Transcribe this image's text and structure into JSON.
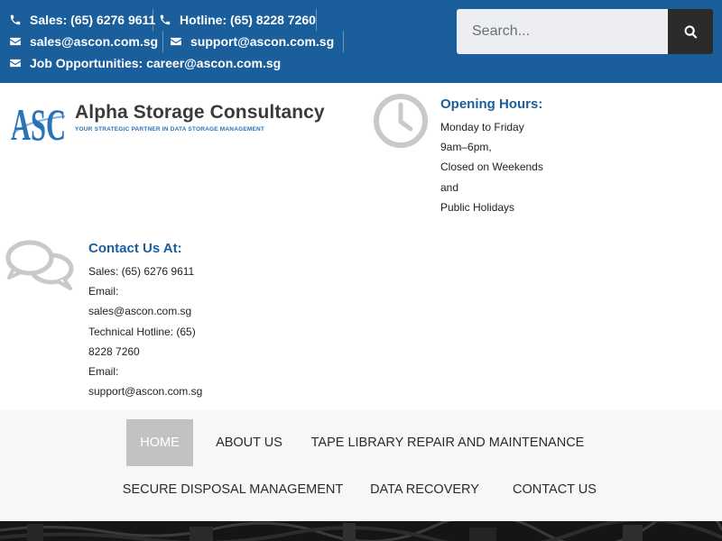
{
  "topbar": {
    "sales": "Sales: (65) 6276 9611",
    "hotline": "Hotline: (65) 8228 7260",
    "sales_email": "sales@ascon.com.sg",
    "support_email": "support@ascon.com.sg",
    "jobs": "Job Opportunities: career@ascon.com.sg",
    "background_color": "#1b5e9c"
  },
  "search": {
    "placeholder": "Search..."
  },
  "logo": {
    "mark": "ASC",
    "name": "Alpha Storage Consultancy",
    "tagline": "YOUR STRATEGIC PARTNER IN DATA STORAGE MANAGEMENT"
  },
  "opening_hours": {
    "title": "Opening Hours:",
    "lines": [
      "Monday to Friday",
      "9am–6pm,",
      "Closed on Weekends",
      "and",
      "Public Holidays"
    ]
  },
  "contact": {
    "title": "Contact Us At:",
    "lines": [
      "Sales: (65) 6276 9611",
      "Email:",
      "sales@ascon.com.sg",
      "Technical Hotline: (65)",
      "8228 7260",
      "Email:",
      "support@ascon.com.sg"
    ]
  },
  "nav": {
    "items": [
      "HOME",
      "ABOUT US",
      "TAPE LIBRARY REPAIR AND MAINTENANCE",
      "SECURE DISPOSAL MANAGEMENT",
      "DATA RECOVERY",
      "CONTACT US"
    ],
    "active": "HOME"
  },
  "icons": {
    "phone": "phone-icon",
    "email": "envelope-icon",
    "search": "search-icon",
    "clock": "clock-icon",
    "chat": "chat-bubbles-icon"
  },
  "colors": {
    "brand_blue": "#1b5e9c",
    "title_blue": "#1b5e9c",
    "icon_gray": "#c9c9c9",
    "nav_active": "#c2c2c2"
  }
}
